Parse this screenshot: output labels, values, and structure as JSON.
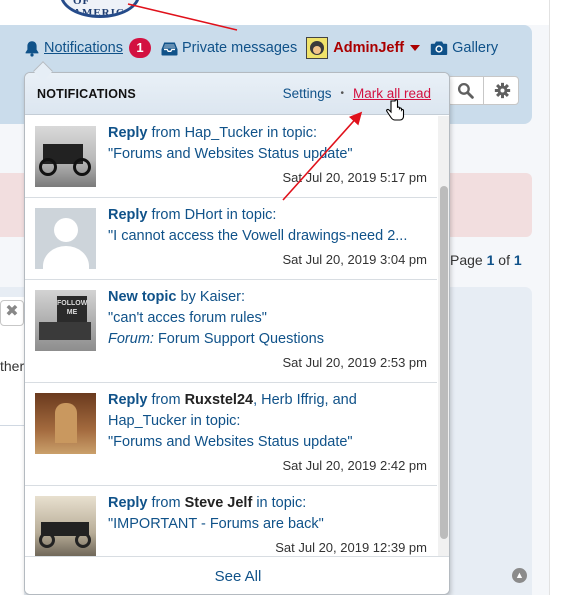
{
  "header": {
    "logo_text": "OF AMERICA",
    "notifications_label": "Notifications",
    "notifications_count": "1",
    "private_messages_label": "Private messages",
    "username": "AdminJeff",
    "gallery_label": "Gallery"
  },
  "background": {
    "pager_prefix": "Page",
    "pager_current": "1",
    "pager_of": "of",
    "pager_total": "1",
    "snippet": "ther",
    "close_glyph": "✖"
  },
  "dropdown": {
    "title": "NOTIFICATIONS",
    "settings_label": "Settings",
    "separator": "•",
    "mark_all_read_label": "Mark all read",
    "see_all_label": "See All",
    "items": [
      {
        "type": "Reply",
        "from_word": "from",
        "authors": [
          {
            "name": "Hap_Tucker",
            "bold": false
          }
        ],
        "suffix": "in topic:",
        "topic": "\"Forums and Websites Status update\"",
        "time": "Sat Jul 20, 2019 5:17 pm",
        "thumb": "car-photo"
      },
      {
        "type": "Reply",
        "from_word": "from",
        "authors": [
          {
            "name": "DHort",
            "bold": false
          }
        ],
        "suffix": "in topic:",
        "topic": "\"I cannot access the Vowell drawings-need 2...",
        "time": "Sat Jul 20, 2019 3:04 pm",
        "thumb": "default-avatar"
      },
      {
        "type": "New topic",
        "from_word": "by",
        "authors": [
          {
            "name": "Kaiser",
            "bold": false
          }
        ],
        "suffix": ":",
        "topic": "\"can't acces forum rules\"",
        "forum_label": "Forum:",
        "forum_name": "Forum Support Questions",
        "time": "Sat Jul 20, 2019 2:53 pm",
        "thumb": "follow-me-photo"
      },
      {
        "type": "Reply",
        "from_word": "from",
        "authors_line": "Ruxstel24",
        "authors_rest": ", Herb Iffrig, and",
        "authors_line2": "Hap_Tucker",
        "suffix": "in topic:",
        "topic": "\"Forums and Websites Status update\"",
        "time": "Sat Jul 20, 2019 2:42 pm",
        "thumb": "sepia-photo"
      },
      {
        "type": "Reply",
        "from_word": "from",
        "authors": [
          {
            "name": "Steve Jelf",
            "bold": true
          }
        ],
        "suffix": "in topic:",
        "topic": "\"IMPORTANT - Forums are back\"",
        "time": "Sat Jul 20, 2019 12:39 pm",
        "thumb": "old-car-photo"
      }
    ]
  },
  "colors": {
    "link_blue": "#105289",
    "badge_red": "#d31141",
    "username_red": "#aa0000",
    "annotation_red": "#e0111b"
  }
}
